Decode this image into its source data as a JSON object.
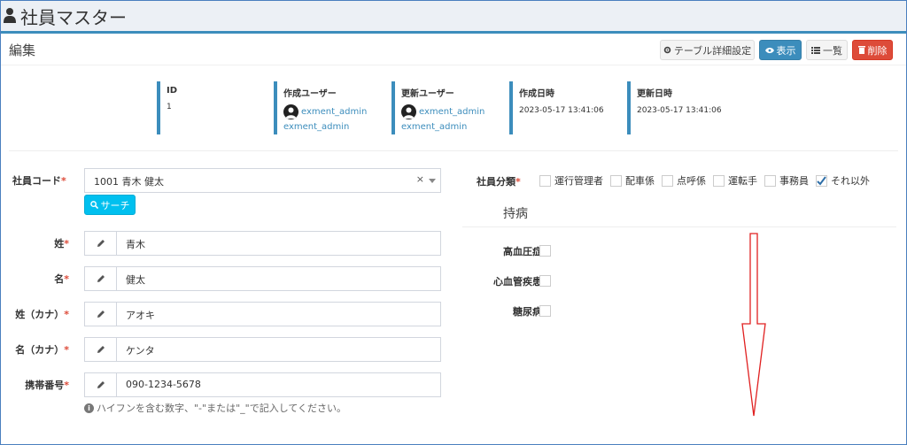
{
  "header": {
    "title": "社員マスター",
    "icon": "user-icon"
  },
  "box": {
    "title": "編集"
  },
  "toolbar": {
    "table_settings_label": "テーブル詳細設定",
    "view_label": "表示",
    "list_label": "一覧",
    "delete_label": "削除"
  },
  "meta": {
    "id_label": "ID",
    "id_value": "1",
    "created_user_label": "作成ユーザー",
    "created_user_name": "exment_admin",
    "created_user_name2": "exment_admin",
    "updated_user_label": "更新ユーザー",
    "updated_user_name": "exment_admin",
    "updated_user_name2": "exment_admin",
    "created_at_label": "作成日時",
    "created_at_value": "2023-05-17 13:41:06",
    "updated_at_label": "更新日時",
    "updated_at_value": "2023-05-17 13:41:06"
  },
  "form": {
    "employee_code_label": "社員コード",
    "employee_code_value": "1001 青木 健太",
    "search_button": "サーチ",
    "last_name_label": "姓",
    "last_name_value": "青木",
    "first_name_label": "名",
    "first_name_value": "健太",
    "last_name_kana_label": "姓（カナ）",
    "last_name_kana_value": "アオキ",
    "first_name_kana_label": "名（カナ）",
    "first_name_kana_value": "ケンタ",
    "mobile_label": "携帯番号",
    "mobile_value": "090-1234-5678",
    "mobile_help": "ハイフンを含む数字、\"-\"または\"_\"で記入してください。",
    "required_mark": "*",
    "clear_mark": "×"
  },
  "classification": {
    "label": "社員分類",
    "options": [
      {
        "label": "運行管理者",
        "checked": false
      },
      {
        "label": "配車係",
        "checked": false
      },
      {
        "label": "点呼係",
        "checked": false
      },
      {
        "label": "運転手",
        "checked": false
      },
      {
        "label": "事務員",
        "checked": false
      },
      {
        "label": "それ以外",
        "checked": true
      }
    ]
  },
  "disease": {
    "title": "持病",
    "items": [
      {
        "label": "高血圧症",
        "checked": false
      },
      {
        "label": "心血管疾患",
        "checked": false
      },
      {
        "label": "糖尿病",
        "checked": false
      }
    ]
  },
  "colors": {
    "primary": "#3c8dbc",
    "danger": "#dd4b39",
    "info": "#00c0ef",
    "arrow": "#e02020"
  }
}
